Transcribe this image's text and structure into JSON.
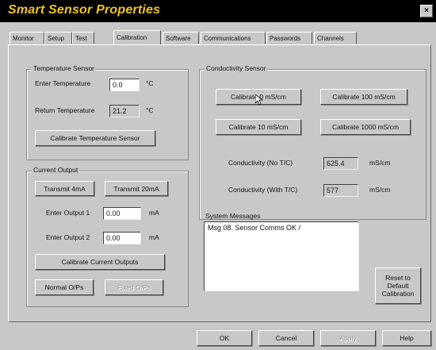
{
  "window": {
    "title": "Smart Sensor Properties",
    "close_label": "×"
  },
  "tabs": [
    "Monitor",
    "Setup",
    "Test",
    "Calibration",
    "Software",
    "Communications",
    "Passwords",
    "Channels"
  ],
  "active_tab": "Calibration",
  "temperature_sensor": {
    "legend": "Temperature Sensor",
    "enter_label": "Enter Temperature",
    "enter_value": "0.0",
    "enter_unit": "°C",
    "return_label": "Return Temperature",
    "return_value": "21.2",
    "return_unit": "°C",
    "calibrate_button": "Calibrate Temperature Sensor"
  },
  "current_output": {
    "legend": "Current Output",
    "transmit_4ma": "Transmit 4mA",
    "transmit_20ma": "Transmit 20mA",
    "output1_label": "Enter Output 1",
    "output1_value": "0.00",
    "output1_unit": "mA",
    "output2_label": "Enter Output 2",
    "output2_value": "0.00",
    "output2_unit": "mA",
    "calibrate_button": "Calibrate Current Outputs",
    "normal_button": "Normal O/Ps",
    "fixed_button": "Fixed O/Ps"
  },
  "conductivity_sensor": {
    "legend": "Conductivity Sensor",
    "cal0": "Calibrate 0 mS/cm",
    "cal100": "Calibrate 100 mS/cm",
    "cal10": "Calibrate 10 mS/cm",
    "cal1000": "Calibrate 1000 mS/cm",
    "no_tc_label": "Conductivity (No T/C)",
    "no_tc_value": "625.4",
    "no_tc_unit": "mS/cm",
    "with_tc_label": "Conductivity (With T/C)",
    "with_tc_value": "577",
    "with_tc_unit": "mS/cm"
  },
  "system_messages": {
    "legend": "System Messages",
    "message": "Msg 08. Sensor Comms OK  /"
  },
  "reset_button": "Reset to Default Calibration",
  "footer": {
    "ok": "OK",
    "cancel": "Cancel",
    "apply": "Apply",
    "help": "Help"
  }
}
